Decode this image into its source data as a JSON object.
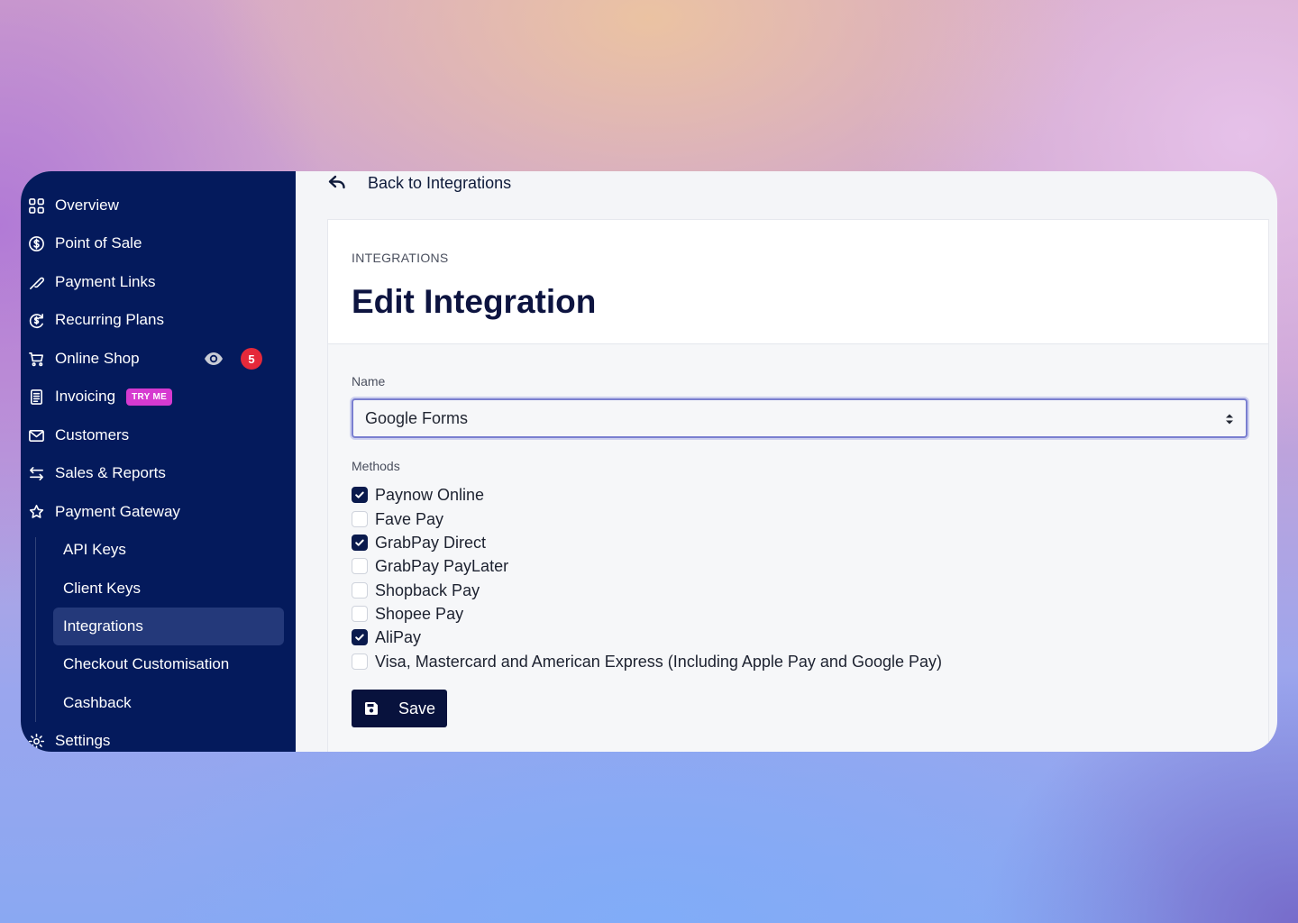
{
  "sidebar": {
    "items": [
      {
        "label": "Overview",
        "icon": "grid-icon"
      },
      {
        "label": "Point of Sale",
        "icon": "dollar-circle-icon"
      },
      {
        "label": "Payment Links",
        "icon": "link-icon"
      },
      {
        "label": "Recurring Plans",
        "icon": "recurring-dollar-icon"
      },
      {
        "label": "Online Shop",
        "icon": "cart-icon",
        "badge": "5",
        "preview_icon": "eye-icon"
      },
      {
        "label": "Invoicing",
        "icon": "invoice-icon",
        "tag": "TRY ME"
      },
      {
        "label": "Customers",
        "icon": "mail-icon"
      },
      {
        "label": "Sales & Reports",
        "icon": "arrows-icon"
      },
      {
        "label": "Payment Gateway",
        "icon": "puzzle-icon"
      }
    ],
    "sub_items": [
      {
        "label": "API Keys"
      },
      {
        "label": "Client Keys"
      },
      {
        "label": "Integrations",
        "active": true
      },
      {
        "label": "Checkout Customisation"
      },
      {
        "label": "Cashback"
      }
    ],
    "settings": {
      "label": "Settings",
      "icon": "gear-icon"
    }
  },
  "back_link": {
    "label": "Back to Integrations",
    "icon": "back-arrow-icon"
  },
  "header": {
    "crumb": "INTEGRATIONS",
    "title": "Edit Integration"
  },
  "form": {
    "name_label": "Name",
    "name_value": "Google Forms",
    "methods_label": "Methods",
    "methods": [
      {
        "label": "Paynow Online",
        "checked": true
      },
      {
        "label": "Fave Pay",
        "checked": false
      },
      {
        "label": "GrabPay Direct",
        "checked": true
      },
      {
        "label": "GrabPay PayLater",
        "checked": false
      },
      {
        "label": "Shopback Pay",
        "checked": false
      },
      {
        "label": "Shopee Pay",
        "checked": false
      },
      {
        "label": "AliPay",
        "checked": true
      },
      {
        "label": "Visa, Mastercard and American Express (Including Apple Pay and Google Pay)",
        "checked": false
      }
    ],
    "save_label": "Save"
  },
  "colors": {
    "sidebar_bg": "#041a5c",
    "active_item_bg": "#24397a",
    "badge_red": "#e5293a",
    "tryme_pink": "#d63ad0",
    "primary_button": "#08123d"
  }
}
